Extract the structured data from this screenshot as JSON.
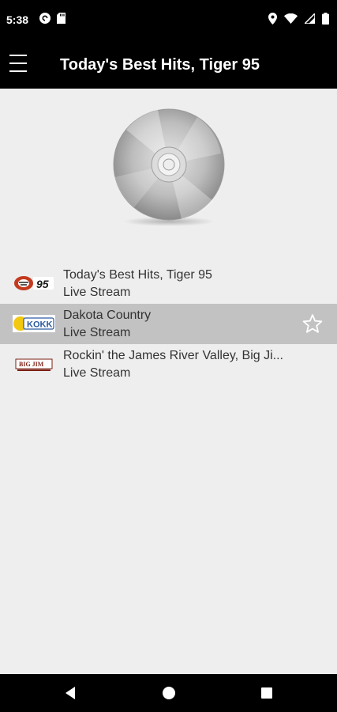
{
  "status_bar": {
    "time": "5:38",
    "left_icons": [
      "pocket-casts-icon",
      "sd-card-icon"
    ],
    "right_icons": [
      "location-icon",
      "wifi-icon",
      "signal-icon",
      "battery-icon"
    ]
  },
  "app_bar": {
    "menu_icon": "hamburger-menu-icon",
    "title": "Today's Best Hits, Tiger 95"
  },
  "artwork": {
    "icon": "compact-disc-icon"
  },
  "stations": [
    {
      "name": "Today's Best Hits, Tiger 95",
      "subtitle": "Live Stream",
      "logo": "tiger-95-logo",
      "logo_text": "95",
      "selected": false
    },
    {
      "name": "Dakota Country",
      "subtitle": "Live Stream",
      "logo": "kokk-logo",
      "logo_text": "KOKK",
      "selected": true
    },
    {
      "name": "Rockin' the James River Valley, Big Ji...",
      "subtitle": "Live Stream",
      "logo": "big-jim-logo",
      "logo_text": "BIG JIM",
      "selected": false
    }
  ],
  "favorite_icon": "star-outline-icon",
  "nav_bar": {
    "icons": [
      "back-icon",
      "home-icon",
      "recents-icon"
    ]
  },
  "colors": {
    "bar_background": "#000000",
    "page_background": "#eeeeee",
    "selected_row": "#c2c2c2",
    "text": "#333333"
  }
}
